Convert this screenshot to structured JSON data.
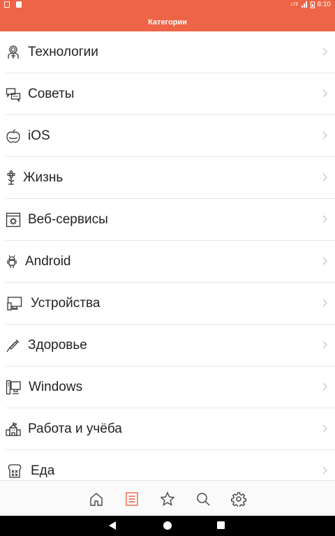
{
  "status_bar": {
    "time": "8:10",
    "network": "LTE"
  },
  "header": {
    "title": "Категории"
  },
  "categories": [
    {
      "label": "Технологии",
      "icon": "astronaut-icon"
    },
    {
      "label": "Советы",
      "icon": "chat-bubbles-icon"
    },
    {
      "label": "iOS",
      "icon": "apple-icon"
    },
    {
      "label": "Жизнь",
      "icon": "flower-icon"
    },
    {
      "label": "Веб-сервисы",
      "icon": "web-gear-icon"
    },
    {
      "label": "Android",
      "icon": "android-robot-icon"
    },
    {
      "label": "Устройства",
      "icon": "devices-icon"
    },
    {
      "label": "Здоровье",
      "icon": "syringe-icon"
    },
    {
      "label": "Windows",
      "icon": "desktop-pc-icon"
    },
    {
      "label": "Работа и учёба",
      "icon": "school-building-icon"
    },
    {
      "label": "Еда",
      "icon": "toast-bread-icon"
    }
  ],
  "bottom_nav": [
    {
      "name": "home",
      "icon": "home-icon",
      "active": false
    },
    {
      "name": "categories",
      "icon": "list-icon",
      "active": true
    },
    {
      "name": "favorites",
      "icon": "star-icon",
      "active": false
    },
    {
      "name": "search",
      "icon": "search-icon",
      "active": false
    },
    {
      "name": "settings",
      "icon": "gear-icon",
      "active": false
    }
  ],
  "colors": {
    "accent": "#EE6446",
    "text": "#222222",
    "divider": "#E6E6E6",
    "icon_inactive": "#444444",
    "chevron": "#C8C8C8"
  }
}
